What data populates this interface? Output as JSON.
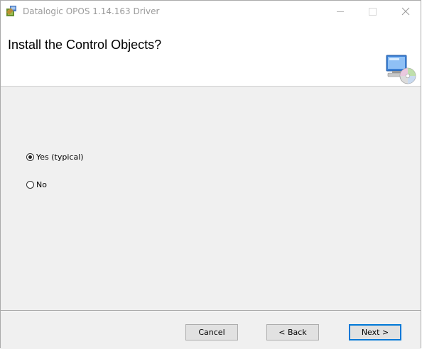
{
  "window": {
    "title": "Datalogic OPOS 1.14.163 Driver",
    "icon": "installer-icon",
    "controls": {
      "minimize": "minimize-icon",
      "maximize": "maximize-icon",
      "close": "×"
    }
  },
  "banner": {
    "title": "Install the Control Objects?",
    "icon": "computer-cd-setup-icon"
  },
  "options": [
    {
      "label": "Yes (typical)",
      "checked": true
    },
    {
      "label": "No",
      "checked": false
    }
  ],
  "buttons": {
    "cancel": "Cancel",
    "back": "< Back",
    "next": "Next >"
  },
  "colors": {
    "accent": "#0078d7",
    "content_bg": "#f0f0f0"
  }
}
